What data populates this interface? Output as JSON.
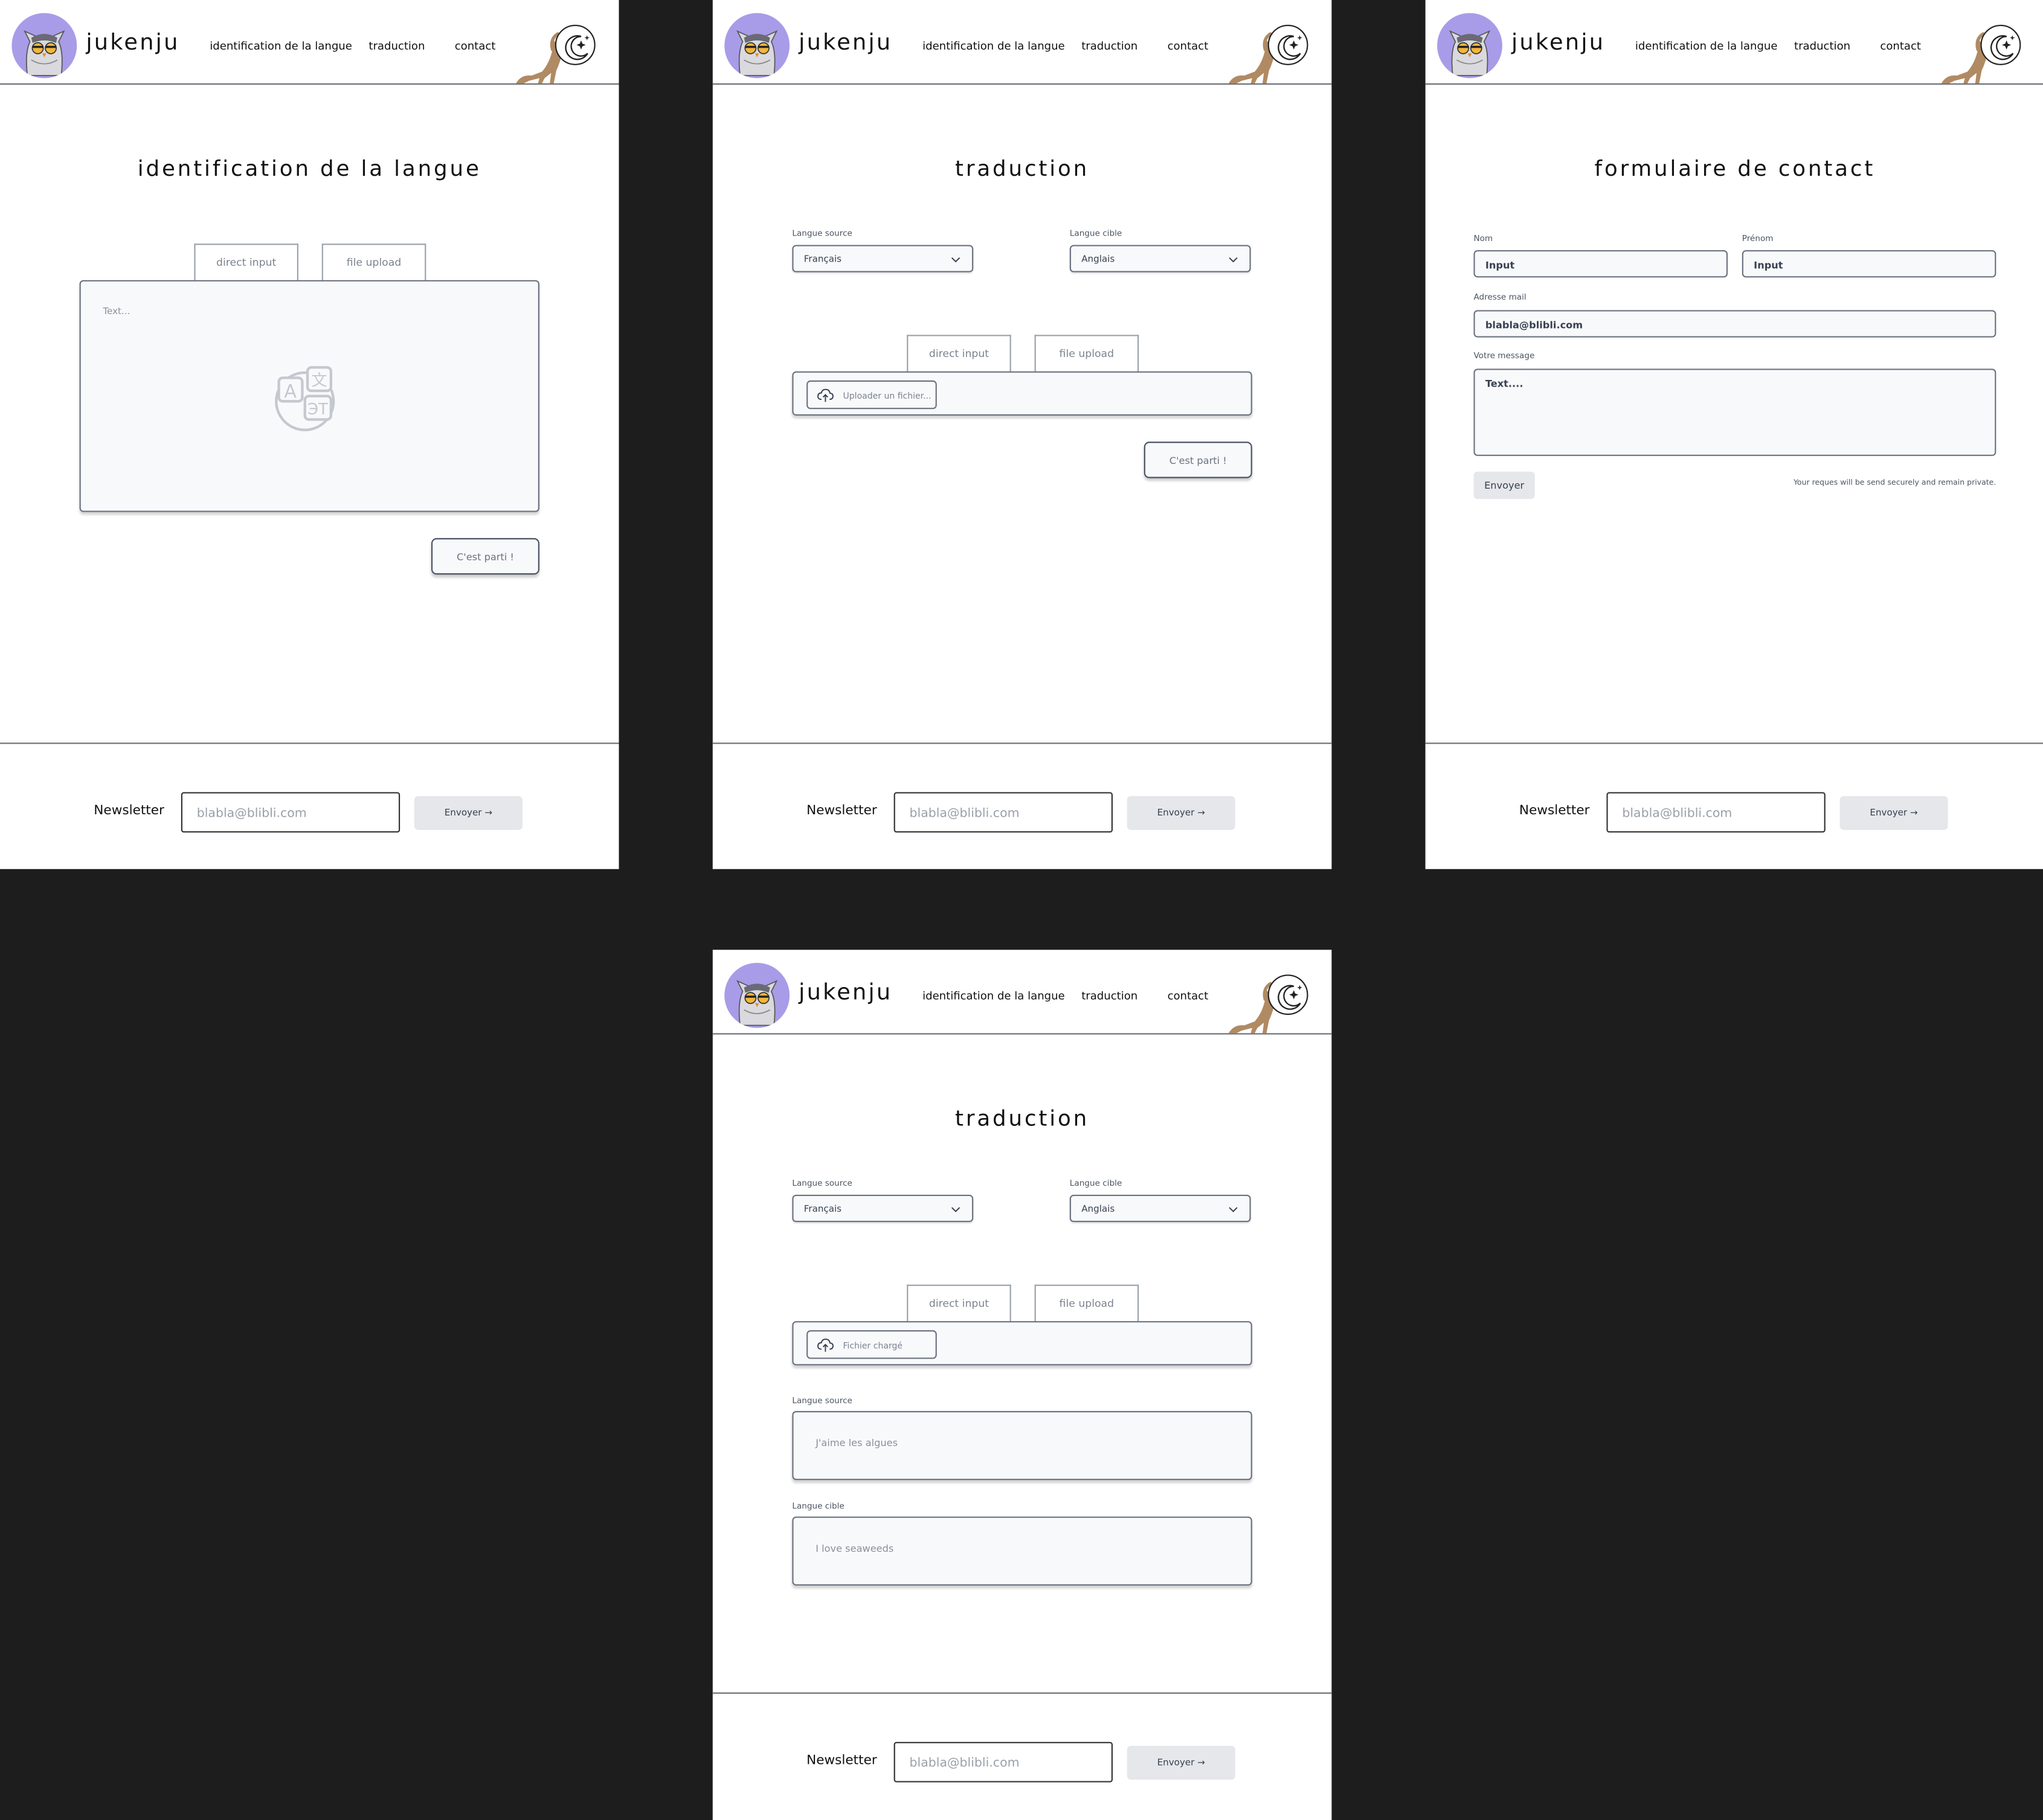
{
  "header": {
    "brand": "jukenju",
    "nav": [
      "identification de la langue",
      "traduction",
      "contact"
    ]
  },
  "footer": {
    "newsletter_label": "Newsletter",
    "newsletter_placeholder": "blabla@blibli.com",
    "send_label": "Envoyer"
  },
  "identification": {
    "title": "identification de la langue",
    "tabs": [
      "direct input",
      "file upload"
    ],
    "text_placeholder": "Text...",
    "go_label": "C'est parti !"
  },
  "translation": {
    "title": "traduction",
    "source_label": "Langue source",
    "source_value": "Français",
    "target_label": "Langue cible",
    "target_value": "Anglais",
    "tabs": [
      "direct input",
      "file upload"
    ],
    "upload_label": "Uploader un fichier...",
    "go_label": "C'est parti !"
  },
  "contact": {
    "title": "formulaire de contact",
    "nom_label": "Nom",
    "nom_value": "Input",
    "prenom_label": "Prénom",
    "prenom_value": "Input",
    "email_label": "Adresse mail",
    "email_value": "blabla@blibli.com",
    "message_label": "Votre message",
    "message_value": "Text....",
    "send_label": "Envoyer",
    "privacy_note": "Your reques will be send securely and remain private."
  },
  "translation_result": {
    "title": "traduction",
    "source_label": "Langue source",
    "source_value": "Français",
    "target_label": "Langue cible",
    "target_value": "Anglais",
    "tabs": [
      "direct input",
      "file upload"
    ],
    "upload_label": "Fichier chargé",
    "result_source_label": "Langue source",
    "result_source_text": "J'aime les algues",
    "result_target_label": "Langue cible",
    "result_target_text": "I love seaweeds"
  },
  "colors": {
    "background": "#1d1d1d",
    "avatar": "#a89ce8",
    "cat": "#b08a63",
    "button_bg": "#e5e7ea"
  }
}
